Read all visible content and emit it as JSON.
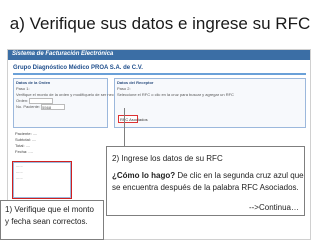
{
  "slide": {
    "title": "a) Verifique sus datos e ingrese su RFC"
  },
  "app": {
    "header": "Sistema de Facturación Electrónica",
    "company": "Grupo Diagnóstico Médico PROA S.A. de C.V.",
    "left_panel": {
      "heading": "Datos de la Orden",
      "step": "Paso 1:",
      "instruction": "Verifique el monto de la orden y modifíquelo de ser necesario",
      "fields": [
        {
          "label": "Orden:",
          "value": ""
        },
        {
          "label": "No. Paciente:",
          "value": "5568"
        }
      ]
    },
    "summary": {
      "lines": [
        "Paciente: ....",
        "Subtotal: ....",
        "Total: ....",
        "Fecha: ...."
      ]
    },
    "right_panel": {
      "heading": "Datos del Receptor",
      "step": "Paso 2:",
      "instruction": "Seleccione el RFC o clic en la cruz para buscar y agregar un RFC",
      "assoc_label": "RFC Asociados"
    }
  },
  "callouts": {
    "step2": {
      "heading": "2) Ingrese los datos de su RFC",
      "question": "¿Cómo lo hago?",
      "line1": " De clic en la segunda cruz azul que",
      "line2": "se encuentra después de la palabra RFC Asociados.",
      "continue": "-->Continua…"
    },
    "step1": {
      "text": "1) Verifique que el monto y fecha sean correctos."
    }
  }
}
